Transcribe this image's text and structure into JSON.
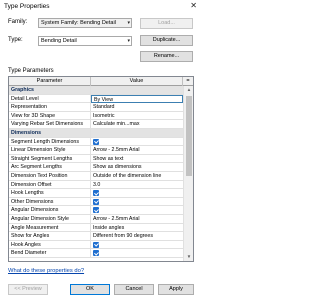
{
  "window": {
    "title": "Type Properties"
  },
  "family": {
    "label": "Family:",
    "value": "System Family: Bending Detail",
    "load_label": "Load..."
  },
  "type": {
    "label": "Type:",
    "value": "Bending Detail",
    "duplicate_label": "Duplicate...",
    "rename_label": "Rename..."
  },
  "type_parameters_label": "Type Parameters",
  "grid": {
    "headers": {
      "parameter": "Parameter",
      "value": "Value",
      "eq": "="
    },
    "rows": [
      {
        "param": "Graphics",
        "group": true,
        "toggle": "≈"
      },
      {
        "param": "Detail Level",
        "value": "By View"
      },
      {
        "param": "Representation",
        "value": "Standard"
      },
      {
        "param": "View for 3D Shape",
        "value": "Isometric"
      },
      {
        "param": "Varying Rebar Set Dimensions",
        "value": "Calculate min...max"
      },
      {
        "param": "Dimensions",
        "group": true,
        "toggle": "≈"
      },
      {
        "param": "Segment Length Dimensions",
        "check": true
      },
      {
        "param": "Linear Dimension Style",
        "value": "Arrow - 2.5mm Arial"
      },
      {
        "param": "Straight Segment Lengths",
        "value": "Show as text"
      },
      {
        "param": "Arc Segment Lengths",
        "value": "Show as dimensions"
      },
      {
        "param": "Dimension Text Position",
        "value": "Outside of the dimension line"
      },
      {
        "param": "Dimension Offset",
        "value": "3.0"
      },
      {
        "param": "Hook Lengths",
        "check": true
      },
      {
        "param": "Other Dimensions",
        "check": true
      },
      {
        "param": "Angular Dimensions",
        "check": true
      },
      {
        "param": "Angular Dimension Style",
        "value": "Arrow - 2.5mm Arial"
      },
      {
        "param": "Angle Measurement",
        "value": "Inside angles"
      },
      {
        "param": "Show for Angles",
        "value": "Different from 90 degrees"
      },
      {
        "param": "Hook Angles",
        "check": true
      },
      {
        "param": "Bend Diameter",
        "check": true
      }
    ]
  },
  "help_link": "What do these properties do?",
  "buttons": {
    "preview": "<< Preview",
    "ok": "OK",
    "cancel": "Cancel",
    "apply": "Apply"
  }
}
